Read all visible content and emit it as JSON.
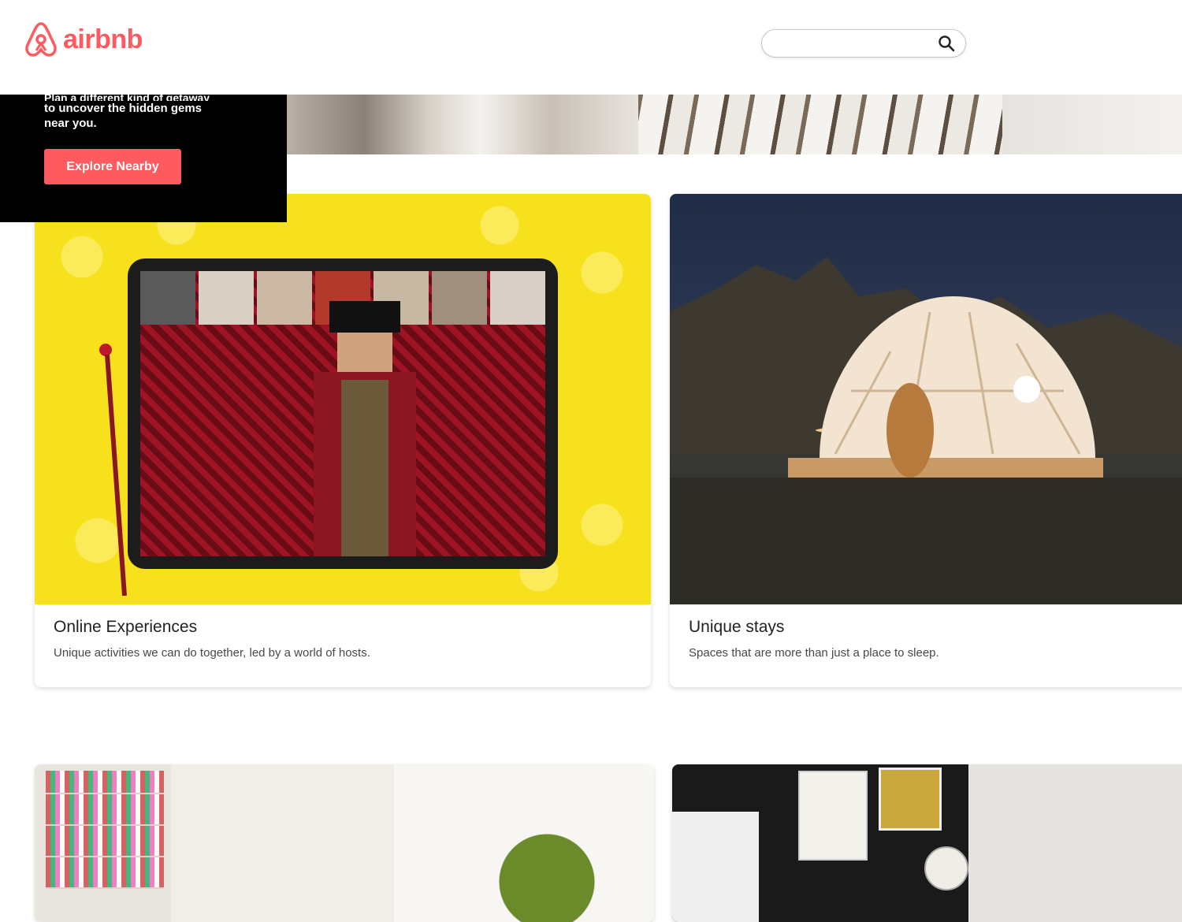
{
  "header": {
    "logo_text": "airbnb",
    "search_placeholder": "",
    "search_value": ""
  },
  "promo": {
    "text_cut": "Plan a different kind of getaway",
    "text_line1": "to uncover the hidden gems",
    "text_line2": "near you.",
    "button_label": "Explore Nearby"
  },
  "cards": [
    {
      "title": "Online Experiences",
      "subtitle": "Unique activities we can do together, led by a world of hosts."
    },
    {
      "title": "Unique stays",
      "subtitle": "Spaces that are more than just a place to sleep."
    }
  ],
  "colors": {
    "brand": "#ff5a5f",
    "promo_bg": "#000000"
  },
  "icons": {
    "logo": "airbnb-belo-icon",
    "search": "search-icon"
  }
}
